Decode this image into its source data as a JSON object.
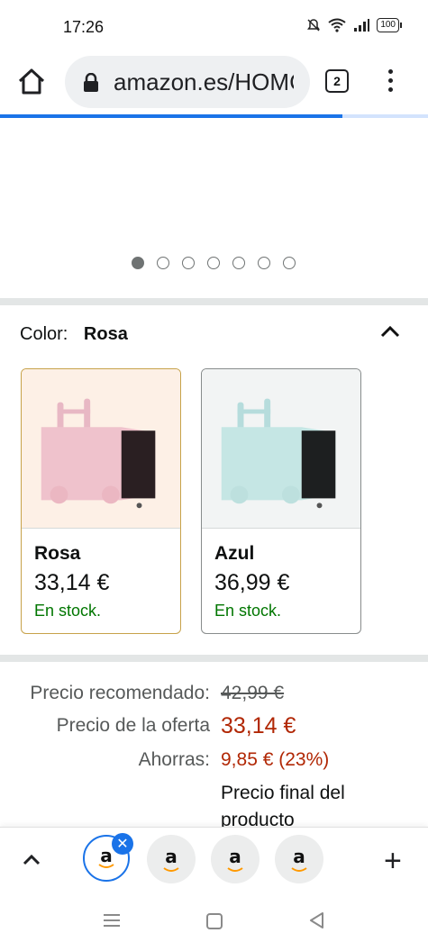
{
  "status_bar": {
    "time": "17:26",
    "battery": "100"
  },
  "browser": {
    "url": "amazon.es/HOMCOM",
    "tab_count": "2",
    "load_progress": 0.8
  },
  "gallery": {
    "image_count": 7,
    "active_index": 0
  },
  "color_selector": {
    "label": "Color:",
    "selected": "Rosa",
    "options": [
      {
        "name": "Rosa",
        "price": "33,14 €",
        "stock": "En stock.",
        "selected": true
      },
      {
        "name": "Azul",
        "price": "36,99 €",
        "stock": "En stock.",
        "selected": false
      }
    ]
  },
  "pricing": {
    "recommended_label": "Precio recomendado:",
    "recommended_value": "42,99 €",
    "deal_label": "Precio de la oferta",
    "deal_value": "33,14 €",
    "savings_label": "Ahorras:",
    "savings_value": "9,85 € (23%)",
    "final_note": "Precio final del producto"
  },
  "tab_strip": {
    "tabs": [
      "a",
      "a",
      "a",
      "a"
    ],
    "active_index": 0
  },
  "colors": {
    "link_blue": "#1a73e8",
    "deal_red": "#b12704",
    "stock_green": "#007600",
    "selected_border": "#c7a24a"
  }
}
